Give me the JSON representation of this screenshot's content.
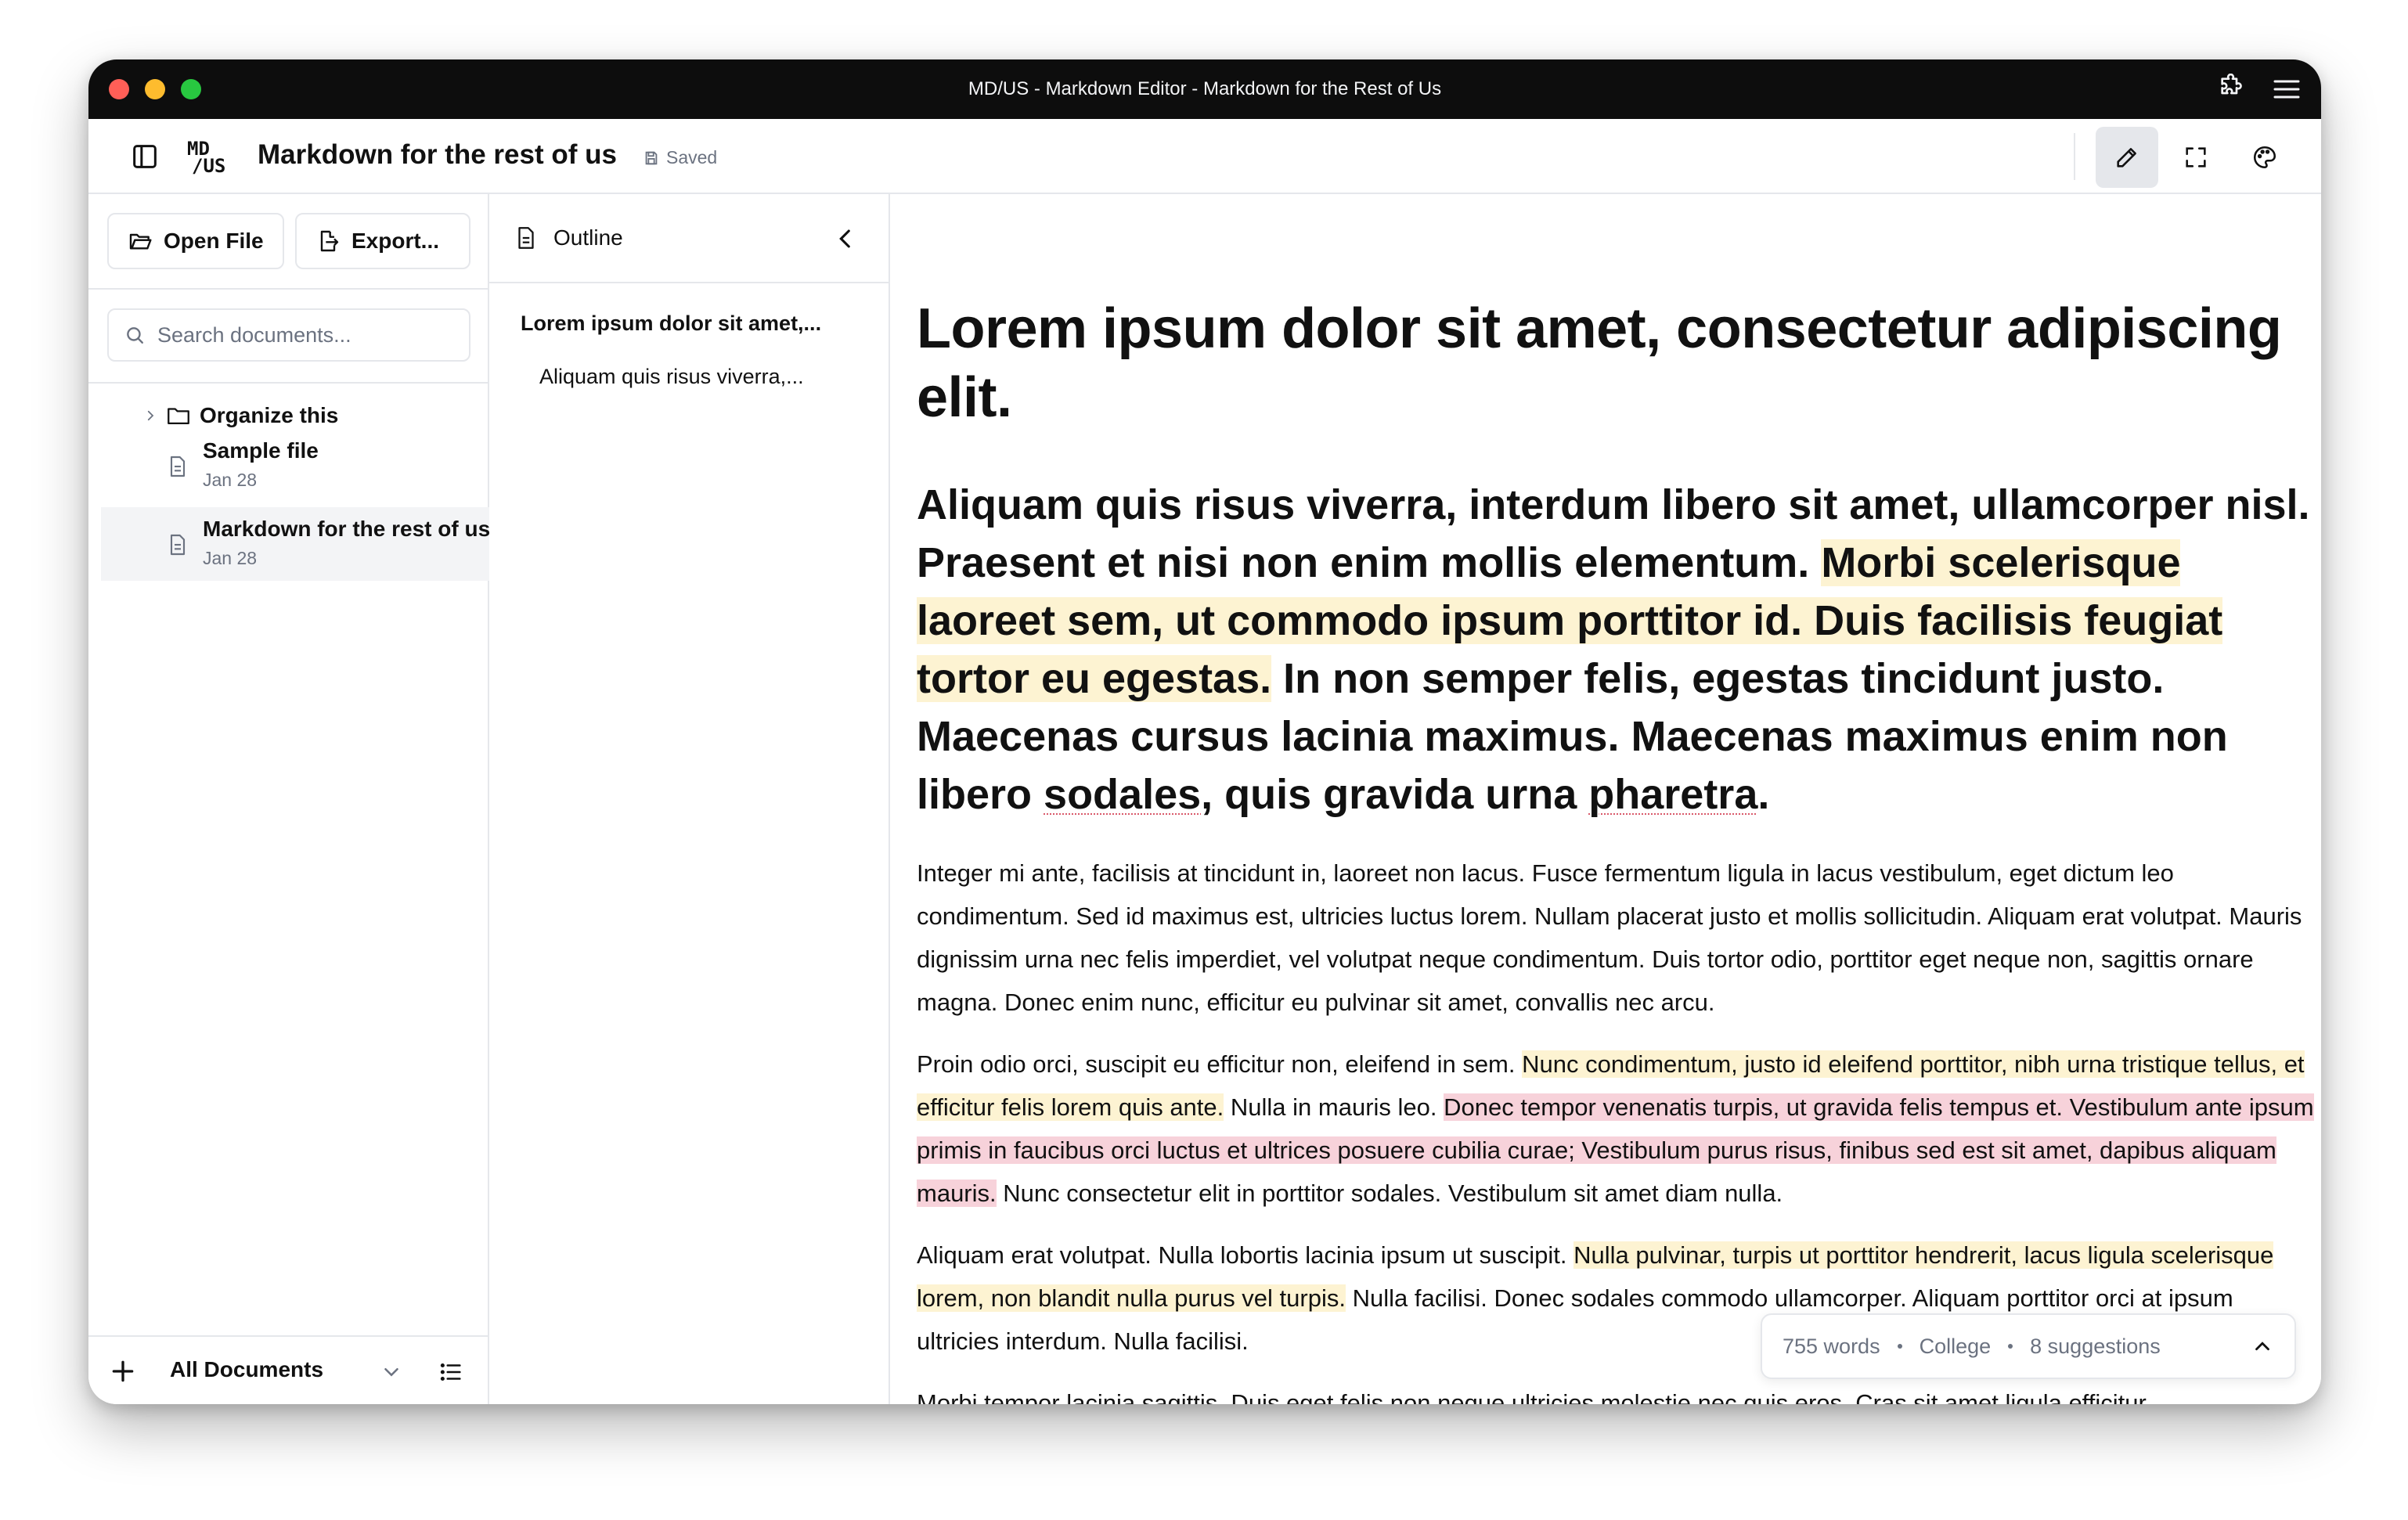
{
  "window": {
    "title": "MD/US - Markdown Editor - Markdown for the Rest of Us"
  },
  "header": {
    "logo_top": "MD",
    "logo_bottom": "/US",
    "doc_title": "Markdown for the rest of us",
    "save_status": "Saved"
  },
  "sidebar": {
    "open_file_label": "Open File",
    "export_label": "Export...",
    "search_placeholder": "Search documents...",
    "folder": "Organize this",
    "files": [
      {
        "name": "Sample file",
        "date": "Jan 28"
      },
      {
        "name": "Markdown for the rest of us",
        "date": "Jan 28"
      }
    ],
    "footer_label": "All Documents"
  },
  "outline": {
    "title": "Outline",
    "items": [
      "Lorem ipsum dolor sit amet,...",
      "Aliquam quis risus viverra,..."
    ]
  },
  "editor": {
    "h1": "Lorem ipsum dolor sit amet, consectetur adipiscing elit.",
    "h2": {
      "a": "Aliquam quis risus viverra, interdum libero sit amet, ullamcorper nisl. Praesent et nisi non enim mollis elementum. ",
      "b": "Morbi scelerisque laoreet sem, ut commodo ipsum porttitor id. Duis facilisis feugiat tortor eu egestas.",
      "c": " In non semper felis, egestas tincidunt justo. Maecenas cursus lacinia maximus. Maecenas maximus enim non libero ",
      "d": "sodales",
      "e": ", quis gravida urna ",
      "f": "pharetra",
      "g": "."
    },
    "p1": "Integer mi ante, facilisis at tincidunt in, laoreet non lacus. Fusce fermentum ligula in lacus vestibulum, eget dictum leo condimentum. Sed id maximus est, ultricies luctus lorem. Nullam placerat justo et mollis sollicitudin. Aliquam erat volutpat. Mauris dignissim urna nec felis imperdiet, vel volutpat neque condimentum. Duis tortor odio, porttitor eget neque non, sagittis ornare magna. Donec enim nunc, efficitur eu pulvinar sit amet, convallis nec arcu.",
    "p2": {
      "a": "Proin odio orci, suscipit eu efficitur non, eleifend in sem. ",
      "b": "Nunc condimentum, justo id eleifend porttitor, nibh urna tristique tellus, et efficitur felis lorem quis ante.",
      "c": " Nulla in mauris leo. ",
      "d": "Donec tempor venenatis turpis, ut gravida felis tempus et. Vestibulum ante ipsum primis in faucibus orci luctus et ultrices posuere cubilia curae; Vestibulum purus risus, finibus sed est sit amet, dapibus aliquam mauris.",
      "e": " Nunc consectetur elit in porttitor sodales. Vestibulum sit amet diam nulla."
    },
    "p3": {
      "a": "Aliquam erat volutpat. Nulla lobortis lacinia ipsum ut suscipit. ",
      "b": "Nulla pulvinar, turpis ut porttitor hendrerit, lacus ligula scelerisque lorem, non blandit nulla purus vel turpis.",
      "c": " Nulla facilisi. Donec sodales commodo ullamcorper. Aliquam porttitor orci at ipsum ultricies interdum. Nulla facilisi."
    },
    "p4": "Morbi tempor lacinia sagittis. Duis eget felis non neque ultricies molestie nec quis eros. Cras sit amet ligula efficitur,"
  },
  "status": {
    "words": "755 words",
    "level": "College",
    "suggestions": "8 suggestions"
  },
  "colors": {
    "highlight_yellow": "#fdf3d2",
    "highlight_pink": "#f7d2da",
    "spell_underline": "#d9596a",
    "titlebar": "#0d0d0d"
  }
}
